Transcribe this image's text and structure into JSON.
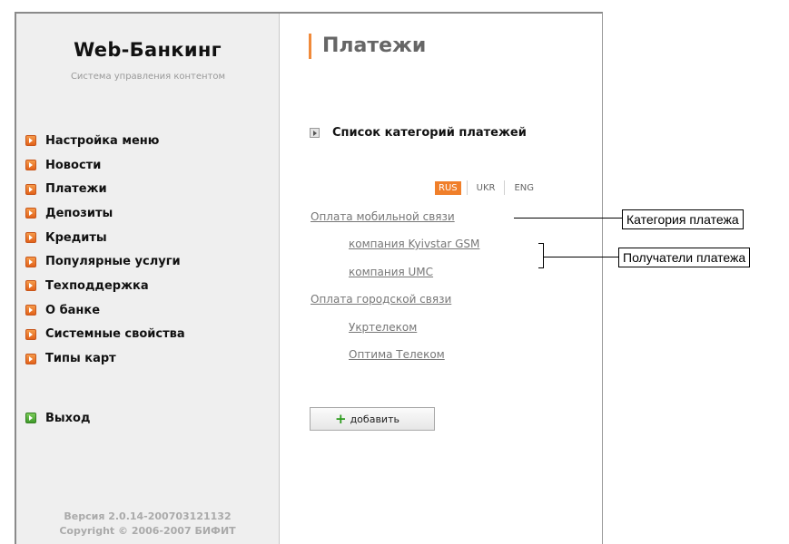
{
  "sidebar": {
    "brand_title": "Web-Банкинг",
    "brand_subtitle": "Система управления контентом",
    "menu_items": [
      {
        "label": "Настройка меню"
      },
      {
        "label": "Новости"
      },
      {
        "label": "Платежи"
      },
      {
        "label": "Депозиты"
      },
      {
        "label": "Кредиты"
      },
      {
        "label": "Популярные услуги"
      },
      {
        "label": "Техподдержка"
      },
      {
        "label": "О банке"
      },
      {
        "label": "Системные свойства"
      },
      {
        "label": "Типы карт"
      }
    ],
    "exit_label": "Выход",
    "version": "Версия 2.0.14-200703121132",
    "copyright": "Copyright © 2006-2007 БИФИТ"
  },
  "main": {
    "page_title": "Платежи",
    "section_title": "Список категорий платежей",
    "languages": [
      {
        "code": "RUS",
        "active": true
      },
      {
        "code": "UKR",
        "active": false
      },
      {
        "code": "ENG",
        "active": false
      }
    ],
    "categories": [
      {
        "label": "Оплата мобильной связи",
        "recipients": [
          "компания Kyivstar GSM",
          "компания UMC"
        ]
      },
      {
        "label": "Оплата городской связи",
        "recipients": [
          "Укртелеком",
          "Оптима Телеком"
        ]
      }
    ],
    "add_button": "добавить"
  },
  "annotations": {
    "category": "Категория платежа",
    "recipients": "Получатели платежа"
  },
  "colors": {
    "accent": "#f07f2a",
    "exit_accent": "#3f9a2a",
    "sidebar_bg": "#efefef"
  }
}
